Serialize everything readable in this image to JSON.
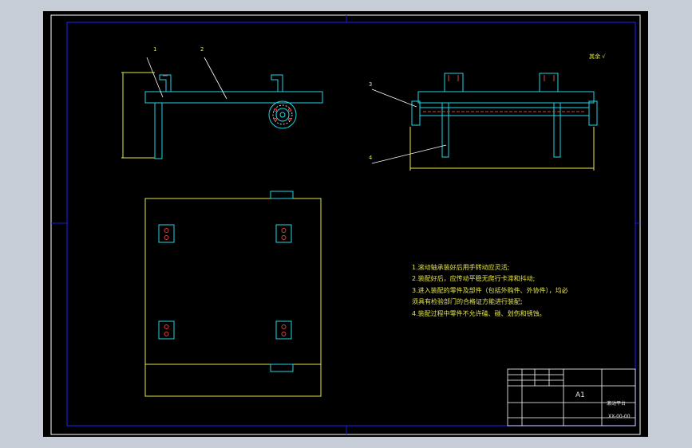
{
  "drawing": {
    "callouts": [
      "1",
      "2",
      "3",
      "4"
    ],
    "roughness_label": "其余",
    "roughness_symbol": "√",
    "technical_requirements": [
      "1.滚动轴承装好后用手转动应灵活;",
      "2.装配好后，应传动平稳无爬行卡滞和抖动;",
      "3.进入装配的零件及部件（包括外购件、外协件），均必",
      "须具有检验部门的合格证方能进行装配;",
      "4.装配过程中零件不允许磕、碰、划伤和锈蚀。"
    ],
    "title_block": {
      "scale_label": "A1",
      "drawing_title": "滚动平台",
      "code": "XX-00-00"
    }
  },
  "colors": {
    "sheet": "#000000",
    "frame": "#1a1ad8",
    "outline": "#e6e64a",
    "part": "#1fd6e6",
    "hole": "#e04040",
    "window": "#c7cdd6"
  }
}
